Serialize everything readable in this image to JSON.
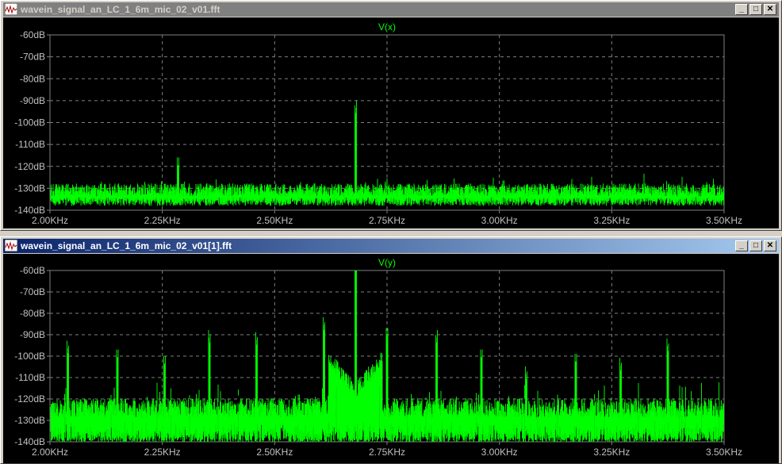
{
  "windows": [
    {
      "title": "wavein_signal_an_LC_1_6m_mic_02_v01.fft",
      "active": false,
      "trace_label": "V(x)",
      "y_ticks": [
        "-60dB",
        "-70dB",
        "-80dB",
        "-90dB",
        "-100dB",
        "-110dB",
        "-120dB",
        "-130dB",
        "-140dB"
      ],
      "x_ticks": [
        "2.00KHz",
        "2.25KHz",
        "2.50KHz",
        "2.75KHz",
        "3.00KHz",
        "3.25KHz",
        "3.50KHz"
      ]
    },
    {
      "title": "wavein_signal_an_LC_1_6m_mic_02_v01[1].fft",
      "active": true,
      "trace_label": "V(y)",
      "y_ticks": [
        "-60dB",
        "-70dB",
        "-80dB",
        "-90dB",
        "-100dB",
        "-110dB",
        "-120dB",
        "-130dB",
        "-140dB"
      ],
      "x_ticks": [
        "2.00KHz",
        "2.25KHz",
        "2.50KHz",
        "2.75KHz",
        "3.00KHz",
        "3.25KHz",
        "3.50KHz"
      ]
    }
  ],
  "window_buttons": {
    "minimize": "_",
    "maximize": "□",
    "close": "✕"
  },
  "colors": {
    "trace": "#00ff00",
    "plot_bg": "#000000",
    "grid": "#808080",
    "axis_text": "#c0c0c0"
  },
  "chart_data": [
    {
      "type": "line",
      "title": "V(x)",
      "xlabel": "",
      "ylabel": "",
      "xlim": [
        2000,
        3500
      ],
      "ylim": [
        -140,
        -60
      ],
      "x_unit": "Hz",
      "y_unit": "dB",
      "grid": true,
      "noise_floor_db": -132,
      "noise_spread_db": 6,
      "peaks": [
        {
          "x": 2680,
          "y": -98
        },
        {
          "x": 2285,
          "y": -123
        }
      ]
    },
    {
      "type": "line",
      "title": "V(y)",
      "xlabel": "",
      "ylabel": "",
      "xlim": [
        2000,
        3500
      ],
      "ylim": [
        -140,
        -60
      ],
      "x_unit": "Hz",
      "y_unit": "dB",
      "grid": true,
      "noise_floor_db": -126,
      "noise_spread_db": 9,
      "peaks": [
        {
          "x": 2680,
          "y": -61
        },
        {
          "x": 2040,
          "y": -101
        },
        {
          "x": 2150,
          "y": -104
        },
        {
          "x": 2255,
          "y": -107
        },
        {
          "x": 2355,
          "y": -96
        },
        {
          "x": 2460,
          "y": -97
        },
        {
          "x": 2610,
          "y": -90
        },
        {
          "x": 2750,
          "y": -94
        },
        {
          "x": 2860,
          "y": -96
        },
        {
          "x": 2960,
          "y": -104
        },
        {
          "x": 3060,
          "y": -113
        },
        {
          "x": 3170,
          "y": -106
        },
        {
          "x": 3270,
          "y": -109
        },
        {
          "x": 3375,
          "y": -100
        }
      ],
      "main_skirt_db": -112
    }
  ]
}
